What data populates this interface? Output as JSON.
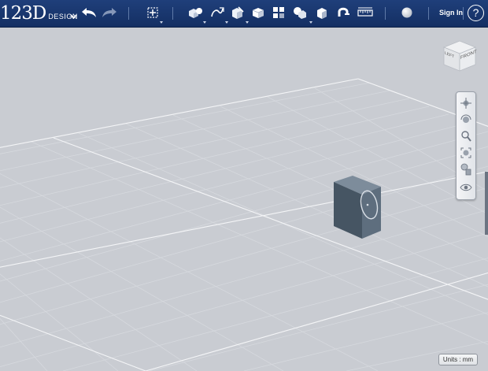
{
  "app": {
    "logo_main": "123D",
    "logo_sub": "DESIGN"
  },
  "toolbar": {
    "items": [
      {
        "id": "undo",
        "icon": "undo-arrow-icon"
      },
      {
        "id": "redo",
        "icon": "redo-arrow-icon"
      },
      {
        "id": "transform",
        "icon": "transform-icon"
      },
      {
        "id": "primitives",
        "icon": "primitives-icon"
      },
      {
        "id": "sketch",
        "icon": "sketch-icon"
      },
      {
        "id": "construct",
        "icon": "construct-icon"
      },
      {
        "id": "modify",
        "icon": "modify-icon"
      },
      {
        "id": "pattern",
        "icon": "pattern-icon"
      },
      {
        "id": "grouping",
        "icon": "grouping-icon"
      },
      {
        "id": "combine",
        "icon": "combine-icon"
      },
      {
        "id": "snap",
        "icon": "snap-magnet-icon"
      },
      {
        "id": "measure",
        "icon": "measure-icon"
      },
      {
        "id": "material",
        "icon": "material-sphere-icon"
      }
    ],
    "sign_in_label": "Sign In",
    "help_label": "?"
  },
  "viewcube": {
    "face_front": "FRONT",
    "face_left": "LEFT"
  },
  "navigation": {
    "items": [
      "pan-icon",
      "orbit-icon",
      "zoom-icon",
      "fit-icon",
      "perspective-icon",
      "visibility-eye-icon"
    ]
  },
  "status": {
    "units_label": "Units : mm"
  },
  "colors": {
    "topbar": "#1b3a73",
    "viewport_bg": "#c9ccd2",
    "grid_line": "#d9dce1",
    "grid_major": "#ffffff",
    "object_front": "#5b6b7b",
    "object_side": "#3f4d5a",
    "object_top": "#7b8b9b"
  }
}
